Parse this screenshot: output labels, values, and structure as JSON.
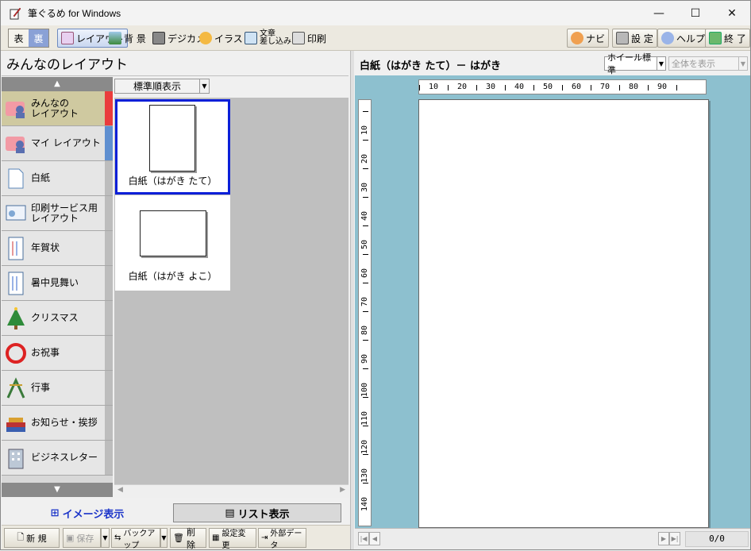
{
  "window": {
    "title": "筆ぐるめ for Windows",
    "minimize": "—",
    "maximize": "☐",
    "close": "✕"
  },
  "toolbar": {
    "front": "表",
    "back": "裏",
    "layout": "レイアウト",
    "background": "背 景",
    "digicam": "デジカメ",
    "illust": "イラスト",
    "text_insert": "文章\n差し込み",
    "print": "印刷",
    "navi": "ナビ",
    "settings": "設 定",
    "help": "ヘルプ",
    "exit": "終 了"
  },
  "left": {
    "title": "みんなのレイアウト",
    "scroll_up": "▲",
    "scroll_down": "▼",
    "sort": "標準順表示",
    "categories": [
      {
        "label": "みんなの\nレイアウト"
      },
      {
        "label": "マイ レイアウト"
      },
      {
        "label": "白紙"
      },
      {
        "label": "印刷サービス用\nレイアウト"
      },
      {
        "label": "年賀状"
      },
      {
        "label": "暑中見舞い"
      },
      {
        "label": "クリスマス"
      },
      {
        "label": "お祝事"
      },
      {
        "label": "行事"
      },
      {
        "label": "お知らせ・挨拶"
      },
      {
        "label": "ビジネスレター"
      }
    ],
    "thumbnails": [
      {
        "caption": "白紙（はがき たて）"
      },
      {
        "caption": "白紙（はがき よこ）"
      }
    ],
    "tabs": {
      "image": "イメージ表示",
      "list": "リスト表示"
    },
    "actions": {
      "new": "新 規",
      "save": "保存",
      "backup": "バックアップ",
      "delete": "削除",
      "change_settings": "設定変更",
      "external": "外部データ"
    }
  },
  "right": {
    "title": "白紙（はがき たて）－ はがき",
    "zoom": "ホイール標準",
    "fit": "全体を表示",
    "ruler_h": [
      "10",
      "20",
      "30",
      "40",
      "50",
      "60",
      "70",
      "80",
      "90"
    ],
    "ruler_v": [
      "10",
      "20",
      "30",
      "40",
      "50",
      "60",
      "70",
      "80",
      "90",
      "100",
      "110",
      "120",
      "130",
      "140"
    ],
    "page_count": "0/0"
  }
}
